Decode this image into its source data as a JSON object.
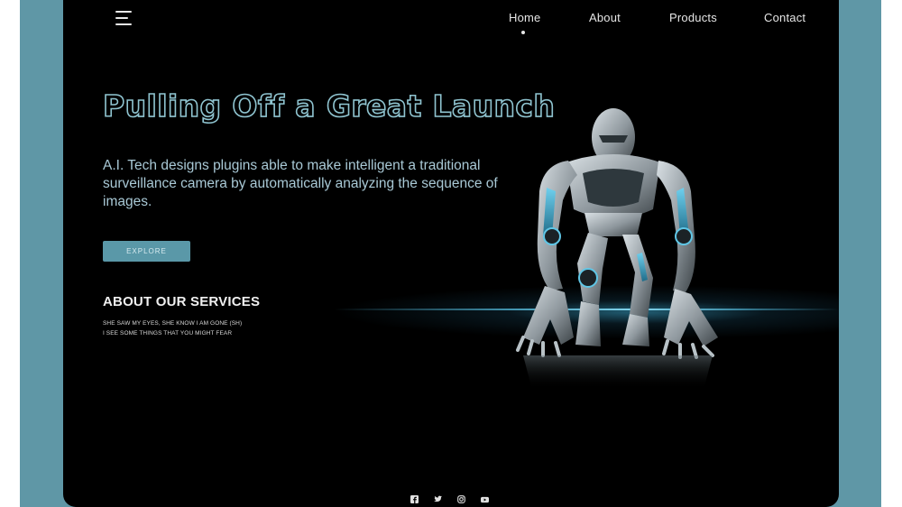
{
  "nav": {
    "items": [
      {
        "label": "Home"
      },
      {
        "label": "About"
      },
      {
        "label": "Products"
      },
      {
        "label": "Contact"
      }
    ],
    "active": "Home"
  },
  "hero": {
    "title": "Pulling Off a Great Launch",
    "description": "A.I. Tech designs plugins able to make intelligent a traditional surveillance camera by automatically analyzing the sequence of images.",
    "cta_label": "EXPLORE"
  },
  "services": {
    "heading": "ABOUT OUR SERVICES",
    "lines": [
      "SHE SAW MY EYES, SHE KNOW I AM GONE (SH)",
      "I SEE SOME THINGS THAT YOU MIGHT FEAR"
    ]
  },
  "socials": [
    "facebook-icon",
    "twitter-icon",
    "instagram-icon",
    "youtube-icon"
  ],
  "colors": {
    "frame": "#5f97a6",
    "background": "#000000",
    "accent": "#5a98a8",
    "title_outline": "#8fc4d0"
  }
}
